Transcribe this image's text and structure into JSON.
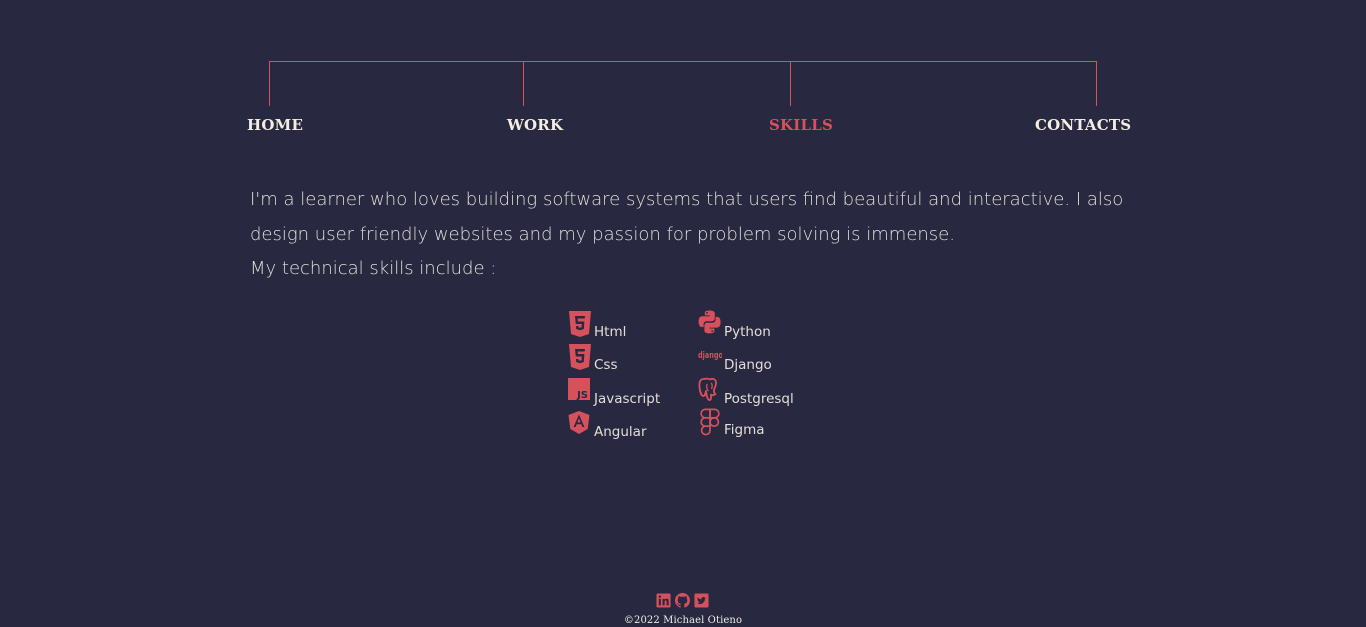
{
  "colors": {
    "background": "#282840",
    "accent": "#d7515c",
    "text": "#e1dcd6"
  },
  "nav": {
    "items": [
      {
        "label": "HOME",
        "active": false
      },
      {
        "label": "WORK",
        "active": false
      },
      {
        "label": "SKILLS",
        "active": true
      },
      {
        "label": "CONTACTS",
        "active": false
      }
    ]
  },
  "intro": {
    "text": "I'm a learner who loves building software systems that users find beautiful and interactive. I also design user friendly websites and my passion for problem solving is immense.\nMy technical skills include :"
  },
  "skills": {
    "left": [
      {
        "label": "Html",
        "icon": "html5-icon"
      },
      {
        "label": "Css",
        "icon": "css3-icon"
      },
      {
        "label": "Javascript",
        "icon": "javascript-icon"
      },
      {
        "label": "Angular",
        "icon": "angular-icon"
      }
    ],
    "right": [
      {
        "label": "Python",
        "icon": "python-icon"
      },
      {
        "label": "Django",
        "icon": "django-icon"
      },
      {
        "label": "Postgresql",
        "icon": "postgresql-icon"
      },
      {
        "label": "Figma",
        "icon": "figma-icon"
      }
    ],
    "django_wordmark": "django"
  },
  "footer": {
    "icons": [
      "linkedin-icon",
      "github-icon",
      "twitter-icon"
    ],
    "copyright": "©2022 Michael Otieno"
  }
}
